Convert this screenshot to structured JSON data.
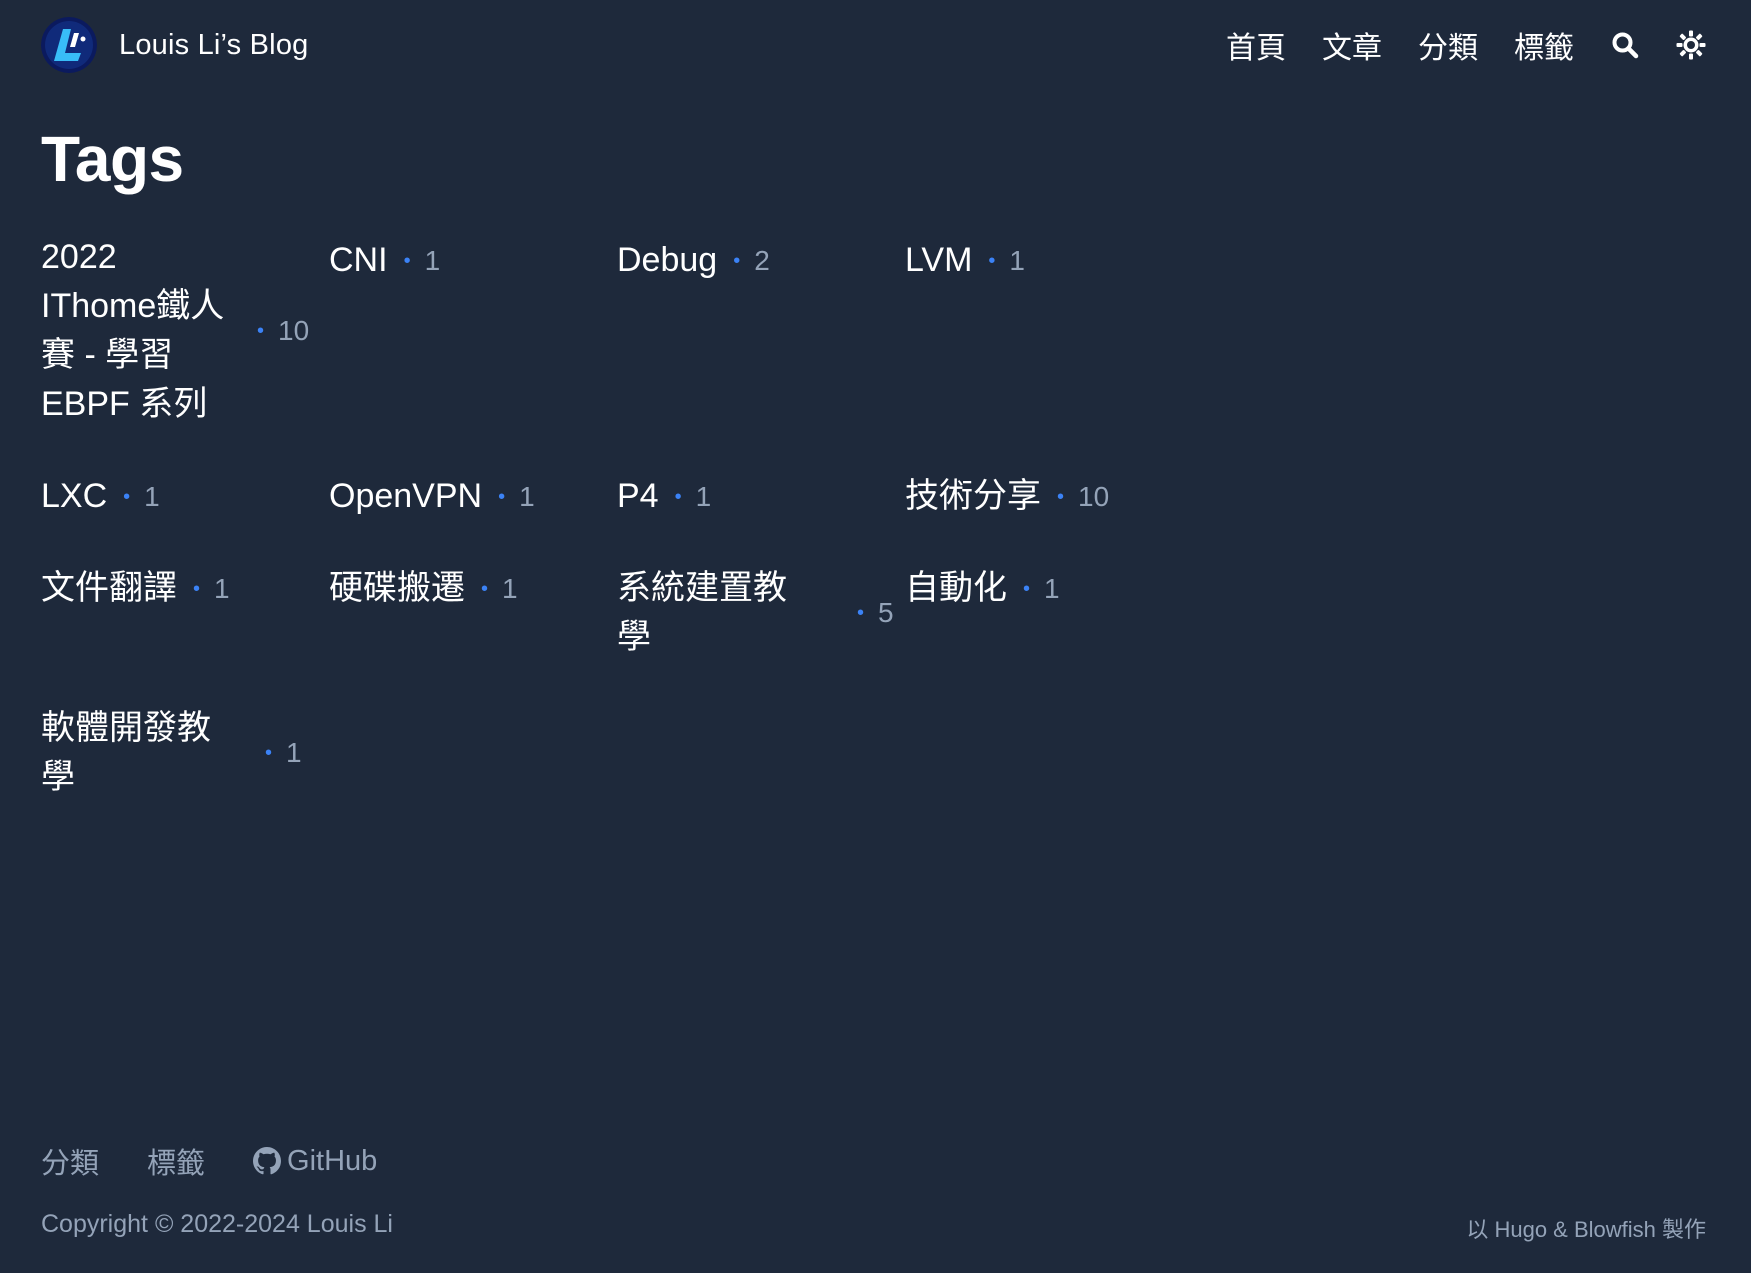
{
  "header": {
    "site_title": "Louis Li’s Blog",
    "logo_text": "L",
    "nav": [
      "首頁",
      "文章",
      "分類",
      "標籤"
    ],
    "search_icon": "search-icon",
    "theme_icon": "sun-icon"
  },
  "page": {
    "title": "Tags"
  },
  "tags": [
    {
      "name": "2022 IThome鐵人賽 - 學習 EBPF 系列",
      "count": "10"
    },
    {
      "name": "CNI",
      "count": "1"
    },
    {
      "name": "Debug",
      "count": "2"
    },
    {
      "name": "LVM",
      "count": "1"
    },
    {
      "name": "LXC",
      "count": "1"
    },
    {
      "name": "OpenVPN",
      "count": "1"
    },
    {
      "name": "P4",
      "count": "1"
    },
    {
      "name": "技術分享",
      "count": "10"
    },
    {
      "name": "文件翻譯",
      "count": "1"
    },
    {
      "name": "硬碟搬遷",
      "count": "1"
    },
    {
      "name": "系統建置教學",
      "count": "5"
    },
    {
      "name": "自動化",
      "count": "1"
    },
    {
      "name": "軟體開發教學",
      "count": "1"
    }
  ],
  "footer": {
    "links": [
      "分類",
      "標籤",
      "GitHub"
    ],
    "github_icon": "github-icon",
    "copyright": "Copyright © 2022-2024 Louis Li",
    "powered": "以 Hugo & Blowfish 製作"
  },
  "colors": {
    "background": "#1e293b",
    "text": "#ffffff",
    "muted": "#94a3b8",
    "accent": "#3b82f6"
  }
}
